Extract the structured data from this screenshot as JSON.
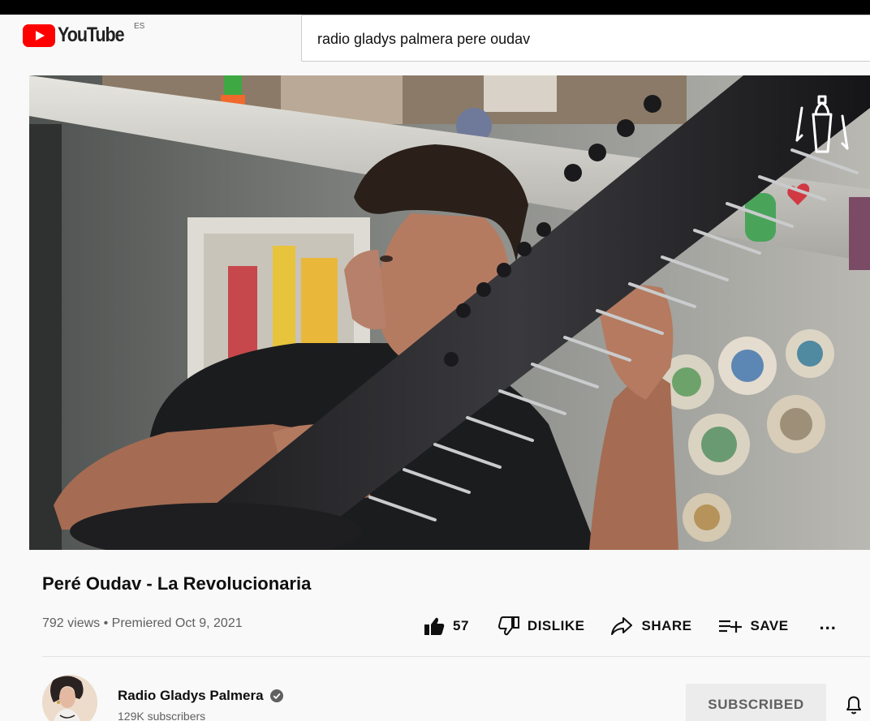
{
  "header": {
    "logo_text": "YouTube",
    "country_code": "ES",
    "search_value": "radio gladys palmera pere oudav"
  },
  "video": {
    "title": "Peré Oudav - La Revolucionaria",
    "stats": "792 views • Premiered Oct 9, 2021"
  },
  "actions": {
    "like_count": "57",
    "dislike_label": "DISLIKE",
    "share_label": "SHARE",
    "save_label": "SAVE",
    "more_label": "..."
  },
  "channel": {
    "name": "Radio Gladys Palmera",
    "subscribers": "129K subscribers",
    "subscribe_label": "SUBSCRIBED"
  },
  "icons": {
    "logo": "youtube-logo-icon",
    "like": "thumbs-up-icon",
    "dislike": "thumbs-down-icon",
    "share": "share-arrow-icon",
    "save": "playlist-add-icon",
    "verified": "verified-check-icon",
    "bell": "notification-bell-icon",
    "watermark": "cocktail-shaker-icon"
  },
  "colors": {
    "brand_red": "#ff0000",
    "background": "#f9f9f9",
    "subscribed_button_bg": "#ececec",
    "secondary_text": "#606060"
  }
}
